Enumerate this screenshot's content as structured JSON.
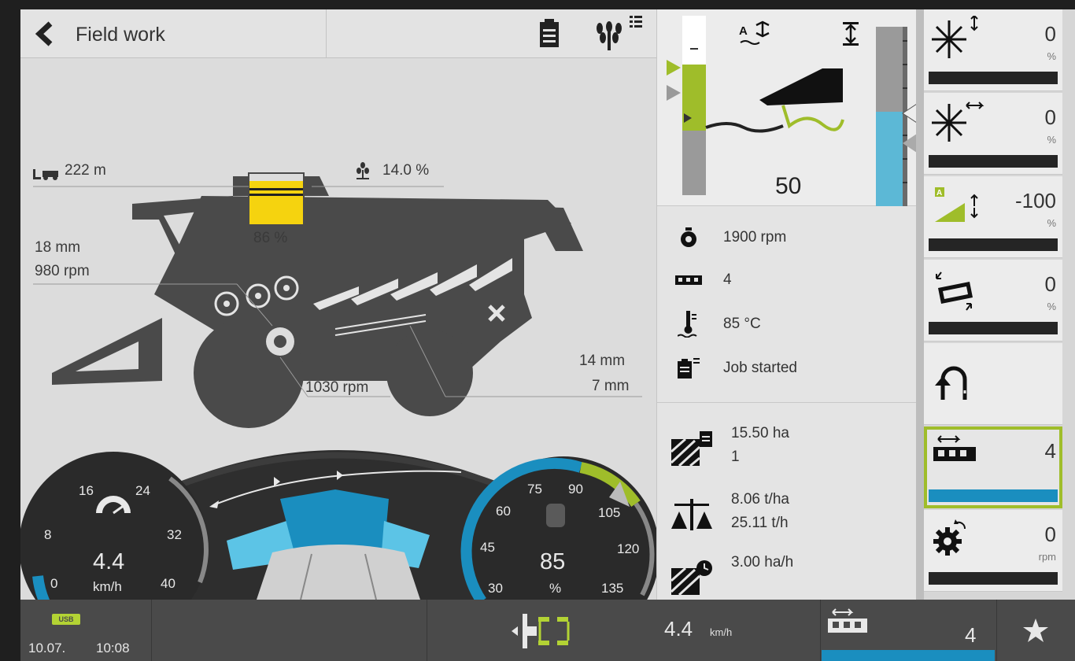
{
  "header": {
    "title": "Field work",
    "back_icon": "chevron-left-icon",
    "clipboard_icon": "clipboard-icon",
    "crop_menu_icon": "crop-list-icon"
  },
  "machine": {
    "grain_tank_fill_percent": 86,
    "grain_tank_label": "86 %",
    "distance": "222 m",
    "moisture": "14.0 %",
    "concave_gap": "18 mm",
    "drum_speed": "980 rpm",
    "fan_speed": "1030 rpm",
    "upper_sieve": "14 mm",
    "lower_sieve": "7 mm",
    "colors": {
      "grain_tank": "#f5d30f",
      "machine_body": "#4a4a4a"
    }
  },
  "gauges": {
    "speed": {
      "value": "4.4",
      "unit": "km/h",
      "current": 4.4,
      "max": 40,
      "ticks": [
        "0",
        "8",
        "16",
        "24",
        "32",
        "40"
      ]
    },
    "load": {
      "value": "85",
      "unit": "%",
      "current": 85,
      "max": 135,
      "ticks": [
        "30",
        "45",
        "60",
        "75",
        "90",
        "105",
        "120",
        "135"
      ]
    },
    "center_labels": [
      "",
      ""
    ]
  },
  "header_height": {
    "value": "50",
    "auto_icon": "auto-height-icon",
    "cut_height_icon": "cut-height-icon",
    "fill_fraction": 0.55
  },
  "status": [
    {
      "icon": "engine-icon",
      "text": "1900 rpm"
    },
    {
      "icon": "gear-box-icon",
      "text": "4"
    },
    {
      "icon": "coolant-temp-icon",
      "text": "85 °C"
    },
    {
      "icon": "job-icon",
      "text": "Job started"
    }
  ],
  "performance": [
    {
      "icon": "area-icon",
      "line1": "15.50 ha",
      "line2": "1"
    },
    {
      "icon": "yield-icon",
      "line1": "8.06 t/ha",
      "line2": "25.11 t/h"
    },
    {
      "icon": "area-rate-icon",
      "line1": "3.00 ha/h",
      "line2": ""
    }
  ],
  "right_panel": [
    {
      "name": "reel-height",
      "icon": "reel-height-icon",
      "value": "0",
      "unit": "%",
      "bar": true
    },
    {
      "name": "reel-position",
      "icon": "reel-position-icon",
      "value": "0",
      "unit": "%",
      "bar": true
    },
    {
      "name": "auto-contour",
      "icon": "auto-contour-icon",
      "value": "-100",
      "unit": "%",
      "bar": true
    },
    {
      "name": "header-tilt",
      "icon": "header-tilt-icon",
      "value": "0",
      "unit": "%",
      "bar": true
    },
    {
      "name": "turn-headland",
      "icon": "headland-turn-icon",
      "value": "",
      "unit": "",
      "bar": false
    },
    {
      "name": "gear-select",
      "icon": "gear-select-icon",
      "value": "4",
      "unit": "",
      "bar": true,
      "selected": true
    },
    {
      "name": "rotor-speed",
      "icon": "rotor-speed-icon",
      "value": "0",
      "unit": "rpm",
      "bar": true
    }
  ],
  "footer": {
    "usb_label": "USB",
    "date": "10.07.",
    "time": "10:08",
    "speed": "4.4",
    "speed_unit": "km/h",
    "gear_value": "4",
    "star_icon": "star-icon"
  },
  "colors": {
    "accent_green": "#9fbd2a",
    "accent_blue": "#1a8ebf",
    "light_blue": "#5cc4e6"
  }
}
